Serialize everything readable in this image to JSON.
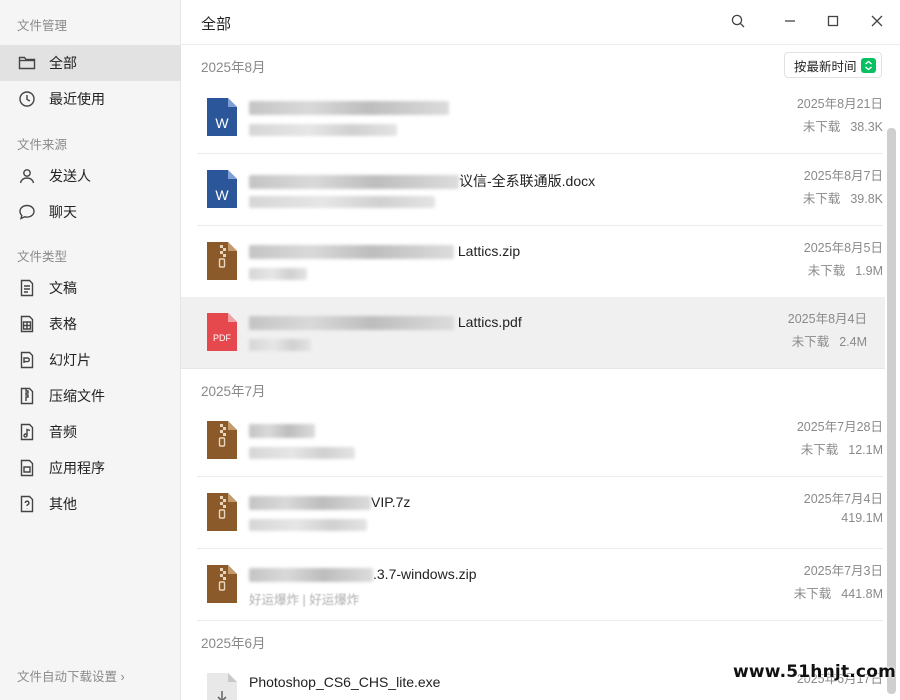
{
  "sidebar": {
    "app_title": "文件管理",
    "top_items": [
      {
        "label": "全部",
        "icon": "folder-icon",
        "active": true
      },
      {
        "label": "最近使用",
        "icon": "clock-icon",
        "active": false
      }
    ],
    "source_header": "文件来源",
    "source_items": [
      {
        "label": "发送人",
        "icon": "person-icon"
      },
      {
        "label": "聊天",
        "icon": "chat-bubble-icon"
      }
    ],
    "type_header": "文件类型",
    "type_items": [
      {
        "label": "文稿",
        "icon": "document-icon"
      },
      {
        "label": "表格",
        "icon": "spreadsheet-icon"
      },
      {
        "label": "幻灯片",
        "icon": "slides-icon"
      },
      {
        "label": "压缩文件",
        "icon": "archive-icon"
      },
      {
        "label": "音频",
        "icon": "music-note-icon"
      },
      {
        "label": "应用程序",
        "icon": "app-icon"
      },
      {
        "label": "其他",
        "icon": "question-file-icon"
      }
    ],
    "footer_link": "文件自动下载设置 ›"
  },
  "header": {
    "title": "全部",
    "icons": [
      "search-icon",
      "minimize-icon",
      "maximize-icon",
      "close-icon"
    ]
  },
  "sort": {
    "label": "按最新时间",
    "accent": "#07c160"
  },
  "sections": [
    {
      "label": "2025年8月",
      "files": [
        {
          "type": "word",
          "name_visible": "",
          "date": "2025年8月21日",
          "status": "未下载",
          "size": "38.3K"
        },
        {
          "type": "word",
          "name_visible": "议信-全系联通版.docx",
          "date": "2025年8月7日",
          "status": "未下载",
          "size": "39.8K"
        },
        {
          "type": "zip",
          "name_visible": "Lattics.zip",
          "date": "2025年8月5日",
          "status": "未下载",
          "size": "1.9M"
        },
        {
          "type": "pdf",
          "name_visible": "Lattics.pdf",
          "date": "2025年8月4日",
          "status": "未下载",
          "size": "2.4M"
        }
      ]
    },
    {
      "label": "2025年7月",
      "files": [
        {
          "type": "zip",
          "name_visible": "",
          "date": "2025年7月28日",
          "status": "未下载",
          "size": "12.1M"
        },
        {
          "type": "zip",
          "name_visible": "VIP.7z",
          "date": "2025年7月4日",
          "status": "",
          "size": "419.1M"
        },
        {
          "type": "zip",
          "name_visible": ".3.7-windows.zip",
          "sub": "好运爆炸 | 好运爆炸",
          "date": "2025年7月3日",
          "status": "未下载",
          "size": "441.8M"
        }
      ]
    },
    {
      "label": "2025年6月",
      "files": [
        {
          "type": "exe",
          "name_visible": "Photoshop_CS6_CHS_lite.exe",
          "date": "2025年6月17日",
          "status": "",
          "size": ""
        }
      ]
    }
  ],
  "colors": {
    "word": "#2b579a",
    "zip": "#8a5a2b",
    "pdf": "#e5484d",
    "exe": "#d9d9d9"
  },
  "watermark": "www.51hnjt.com"
}
